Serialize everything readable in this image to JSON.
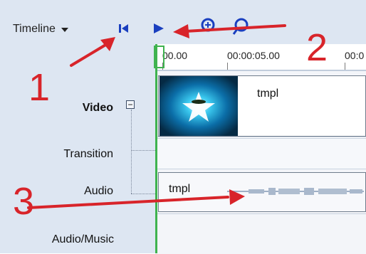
{
  "toolbar": {
    "dropdown_label": "Timeline"
  },
  "tracks": {
    "video": "Video",
    "transition": "Transition",
    "audio": "Audio",
    "audio_music": "Audio/Music",
    "collapse_symbol": "−"
  },
  "ruler": {
    "t0": "00.00",
    "t5": "00:00:05.00",
    "t10": "00:0"
  },
  "clips": {
    "video_clip_name": "tmpl",
    "audio_clip_name": "tmpl"
  },
  "annotations": {
    "n1": "1",
    "n2": "2",
    "n3": "3"
  },
  "colors": {
    "panel": "#dde6f2",
    "playhead": "#3fb34f",
    "annotation_red": "#d8242a",
    "play_blue": "#1a3fbf"
  }
}
